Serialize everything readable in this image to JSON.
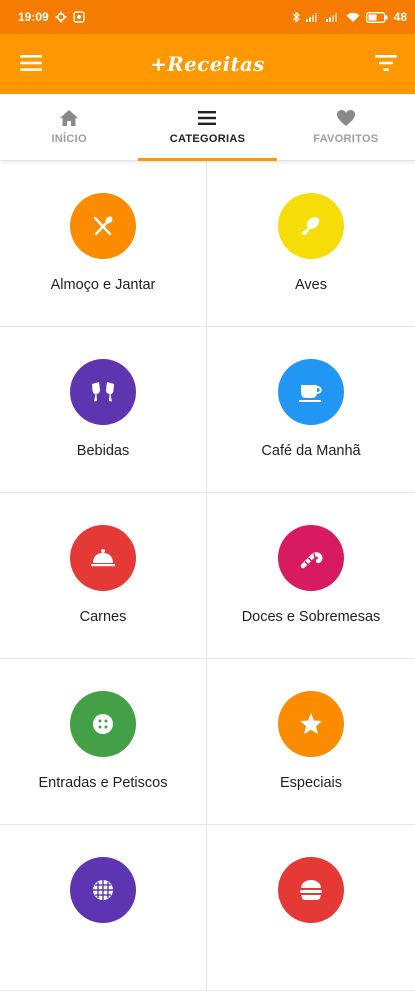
{
  "status": {
    "time": "19:09",
    "battery": "48"
  },
  "app": {
    "title": "+Receitas"
  },
  "tabs": [
    {
      "label": "INÍCIO",
      "icon": "home-icon",
      "active": false
    },
    {
      "label": "CATEGORIAS",
      "icon": "list-icon",
      "active": true
    },
    {
      "label": "FAVORITOS",
      "icon": "heart-icon",
      "active": false
    }
  ],
  "categories": [
    {
      "label": "Almoço e Jantar",
      "color": "#fb8c00",
      "icon": "cutlery-icon"
    },
    {
      "label": "Aves",
      "color": "#f7dd07",
      "icon": "drumstick-icon"
    },
    {
      "label": "Bebidas",
      "color": "#5e35b1",
      "icon": "toast-glasses-icon"
    },
    {
      "label": "Café da Manhã",
      "color": "#2196f3",
      "icon": "coffee-cup-icon"
    },
    {
      "label": "Carnes",
      "color": "#e53935",
      "icon": "cloche-icon"
    },
    {
      "label": "Doces e Sobremesas",
      "color": "#d81b60",
      "icon": "candy-cane-icon"
    },
    {
      "label": "Entradas e Petiscos",
      "color": "#43a047",
      "icon": "cookie-icon"
    },
    {
      "label": "Especiais",
      "color": "#fb8c00",
      "icon": "star-icon"
    },
    {
      "label": "",
      "color": "#5e35b1",
      "icon": "waffle-icon"
    },
    {
      "label": "",
      "color": "#e53935",
      "icon": "burger-icon"
    }
  ]
}
